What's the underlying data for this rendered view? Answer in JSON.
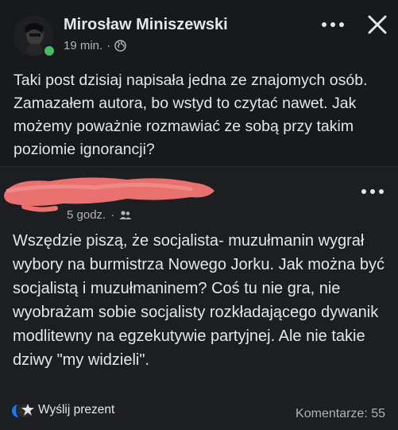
{
  "post": {
    "author": "Mirosław Miniszewski",
    "time": "19 min.",
    "separator": "·",
    "privacy_icon": "globe-icon",
    "text": "Taki post dzisiaj napisała jedna ze znajomych osób. Zamazałem autora, bo wstyd to czytać nawet. Jak możemy poważnie rozmawiać ze sobą przy takim poziomie ignorancji?"
  },
  "shared_post": {
    "time": "5 godz.",
    "separator": "·",
    "audience_icon": "friends-icon",
    "text": "Wszędzie piszą, że socjalista- muzułmanin wygrał wybory na burmistrza Nowego Jorku. Jak można być socjalistą i muzułmaninem? Coś tu nie gra, nie wyobrażam sobie socjalisty rozkładającego dywanik modlitewny na egzekutywie partyjnej. Ale nie takie dziwy \"my widzieli\".",
    "gift_label": "Wyślij prezent",
    "comments": "Komentarze: 55"
  },
  "colors": {
    "background": "#17191c",
    "text": "#e4e6eb",
    "muted": "#b0b3b8",
    "redaction": "#e8706e",
    "online": "#45bd62"
  }
}
